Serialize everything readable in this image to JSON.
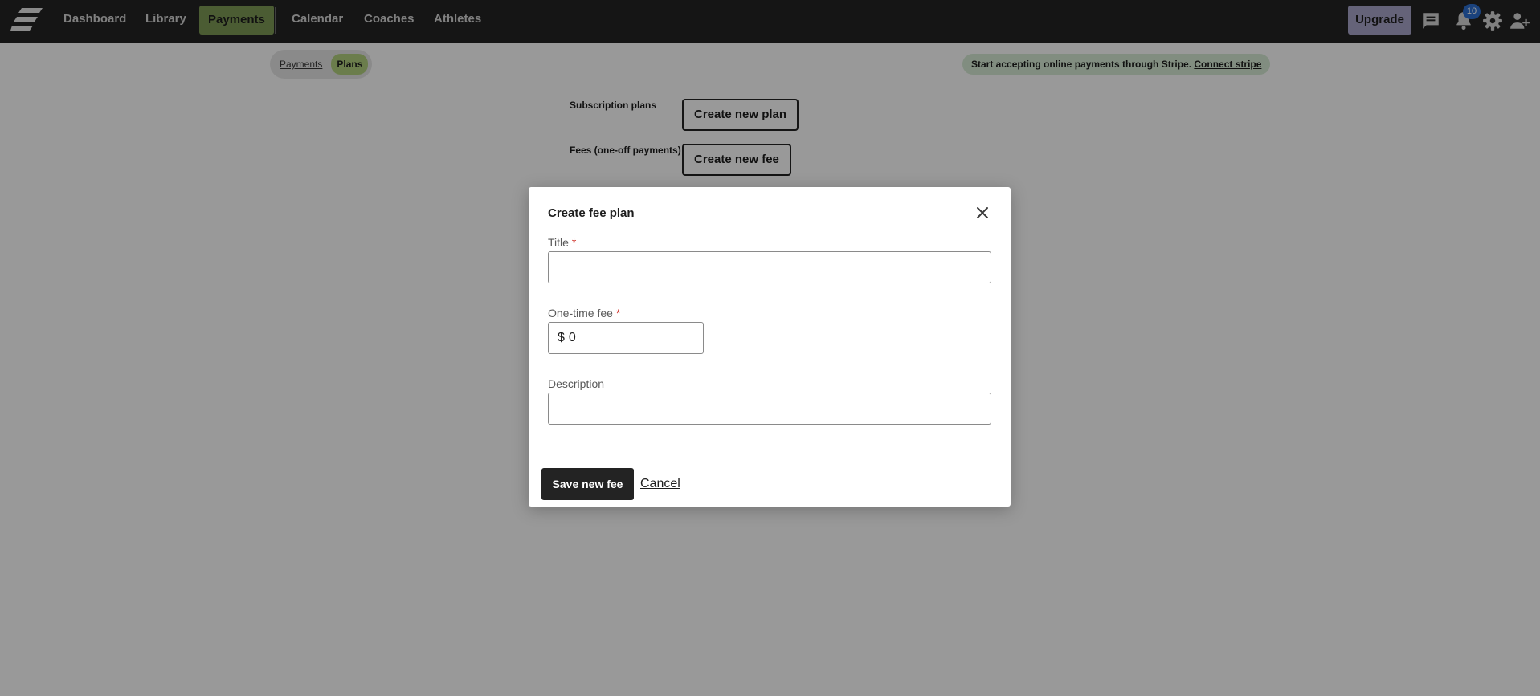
{
  "nav": {
    "items": [
      {
        "label": "Dashboard"
      },
      {
        "label": "Library"
      },
      {
        "label": "Payments"
      },
      {
        "label": "Calendar"
      },
      {
        "label": "Coaches"
      },
      {
        "label": "Athletes"
      }
    ],
    "active_item": "Payments",
    "upgrade_label": "Upgrade",
    "notification_count": "10",
    "icons": [
      "logo-icon",
      "chat-icon",
      "bell-icon",
      "gear-icon",
      "add-user-icon"
    ]
  },
  "page": {
    "subtabs": [
      {
        "label": "Payments",
        "active": false
      },
      {
        "label": "Plans",
        "active": true
      }
    ],
    "stripe_banner": {
      "text": "Start accepting online payments through Stripe.",
      "link": "Connect stripe"
    },
    "subscription_label": "Subscription plans",
    "create_plan_button": "Create new plan",
    "fees_label": "Fees (one-off payments)",
    "create_fee_button": "Create new fee"
  },
  "modal": {
    "title": "Create fee plan",
    "fields": {
      "title": {
        "label": "Title",
        "required_mark": "*",
        "value": ""
      },
      "fee": {
        "label": "One-time fee",
        "required_mark": "*",
        "currency": "$",
        "value": "0"
      },
      "description": {
        "label": "Description",
        "value": ""
      }
    },
    "save_button": "Save new fee",
    "cancel_link": "Cancel"
  },
  "colors": {
    "nav_bg": "#232323",
    "nav_active_bg": "#7e9a55",
    "upgrade_bg": "#a9a6ca",
    "subtab_active_bg": "#b2d07f",
    "banner_bg": "#d8ecd5",
    "badge_bg": "#2c6fd1",
    "required": "#d0342c"
  }
}
